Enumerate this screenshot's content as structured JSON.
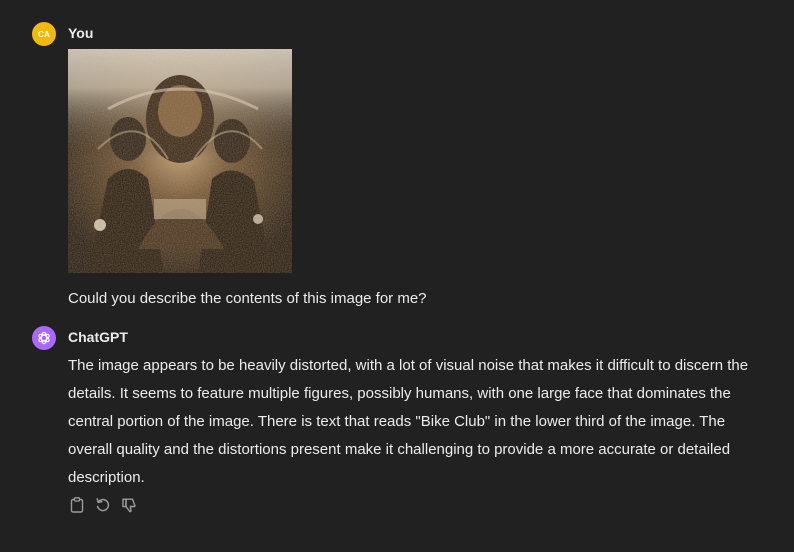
{
  "conversation": {
    "user_message": {
      "avatar_initials": "CA",
      "author": "You",
      "image_icon": "attached-photo",
      "text": "Could you describe the contents of this image for me?"
    },
    "assistant_message": {
      "avatar_icon": "openai-logo-icon",
      "author": "ChatGPT",
      "text": "The image appears to be heavily distorted, with a lot of visual noise that makes it difficult to discern the details. It seems to feature multiple figures, possibly humans, with one large face that dominates the central portion of the image. There is text that reads \"Bike Club\" in the lower third of the image. The overall quality and the distortions present make it challenging to provide a more accurate or detailed description.",
      "actions": [
        "copy-icon",
        "regenerate-icon",
        "thumbs-down-icon"
      ]
    }
  },
  "colors": {
    "background": "#212121",
    "text": "#ececec",
    "user_avatar": "#f0b90b",
    "assistant_avatar": "#ab68ff",
    "action_icon": "#9b9b9b"
  }
}
